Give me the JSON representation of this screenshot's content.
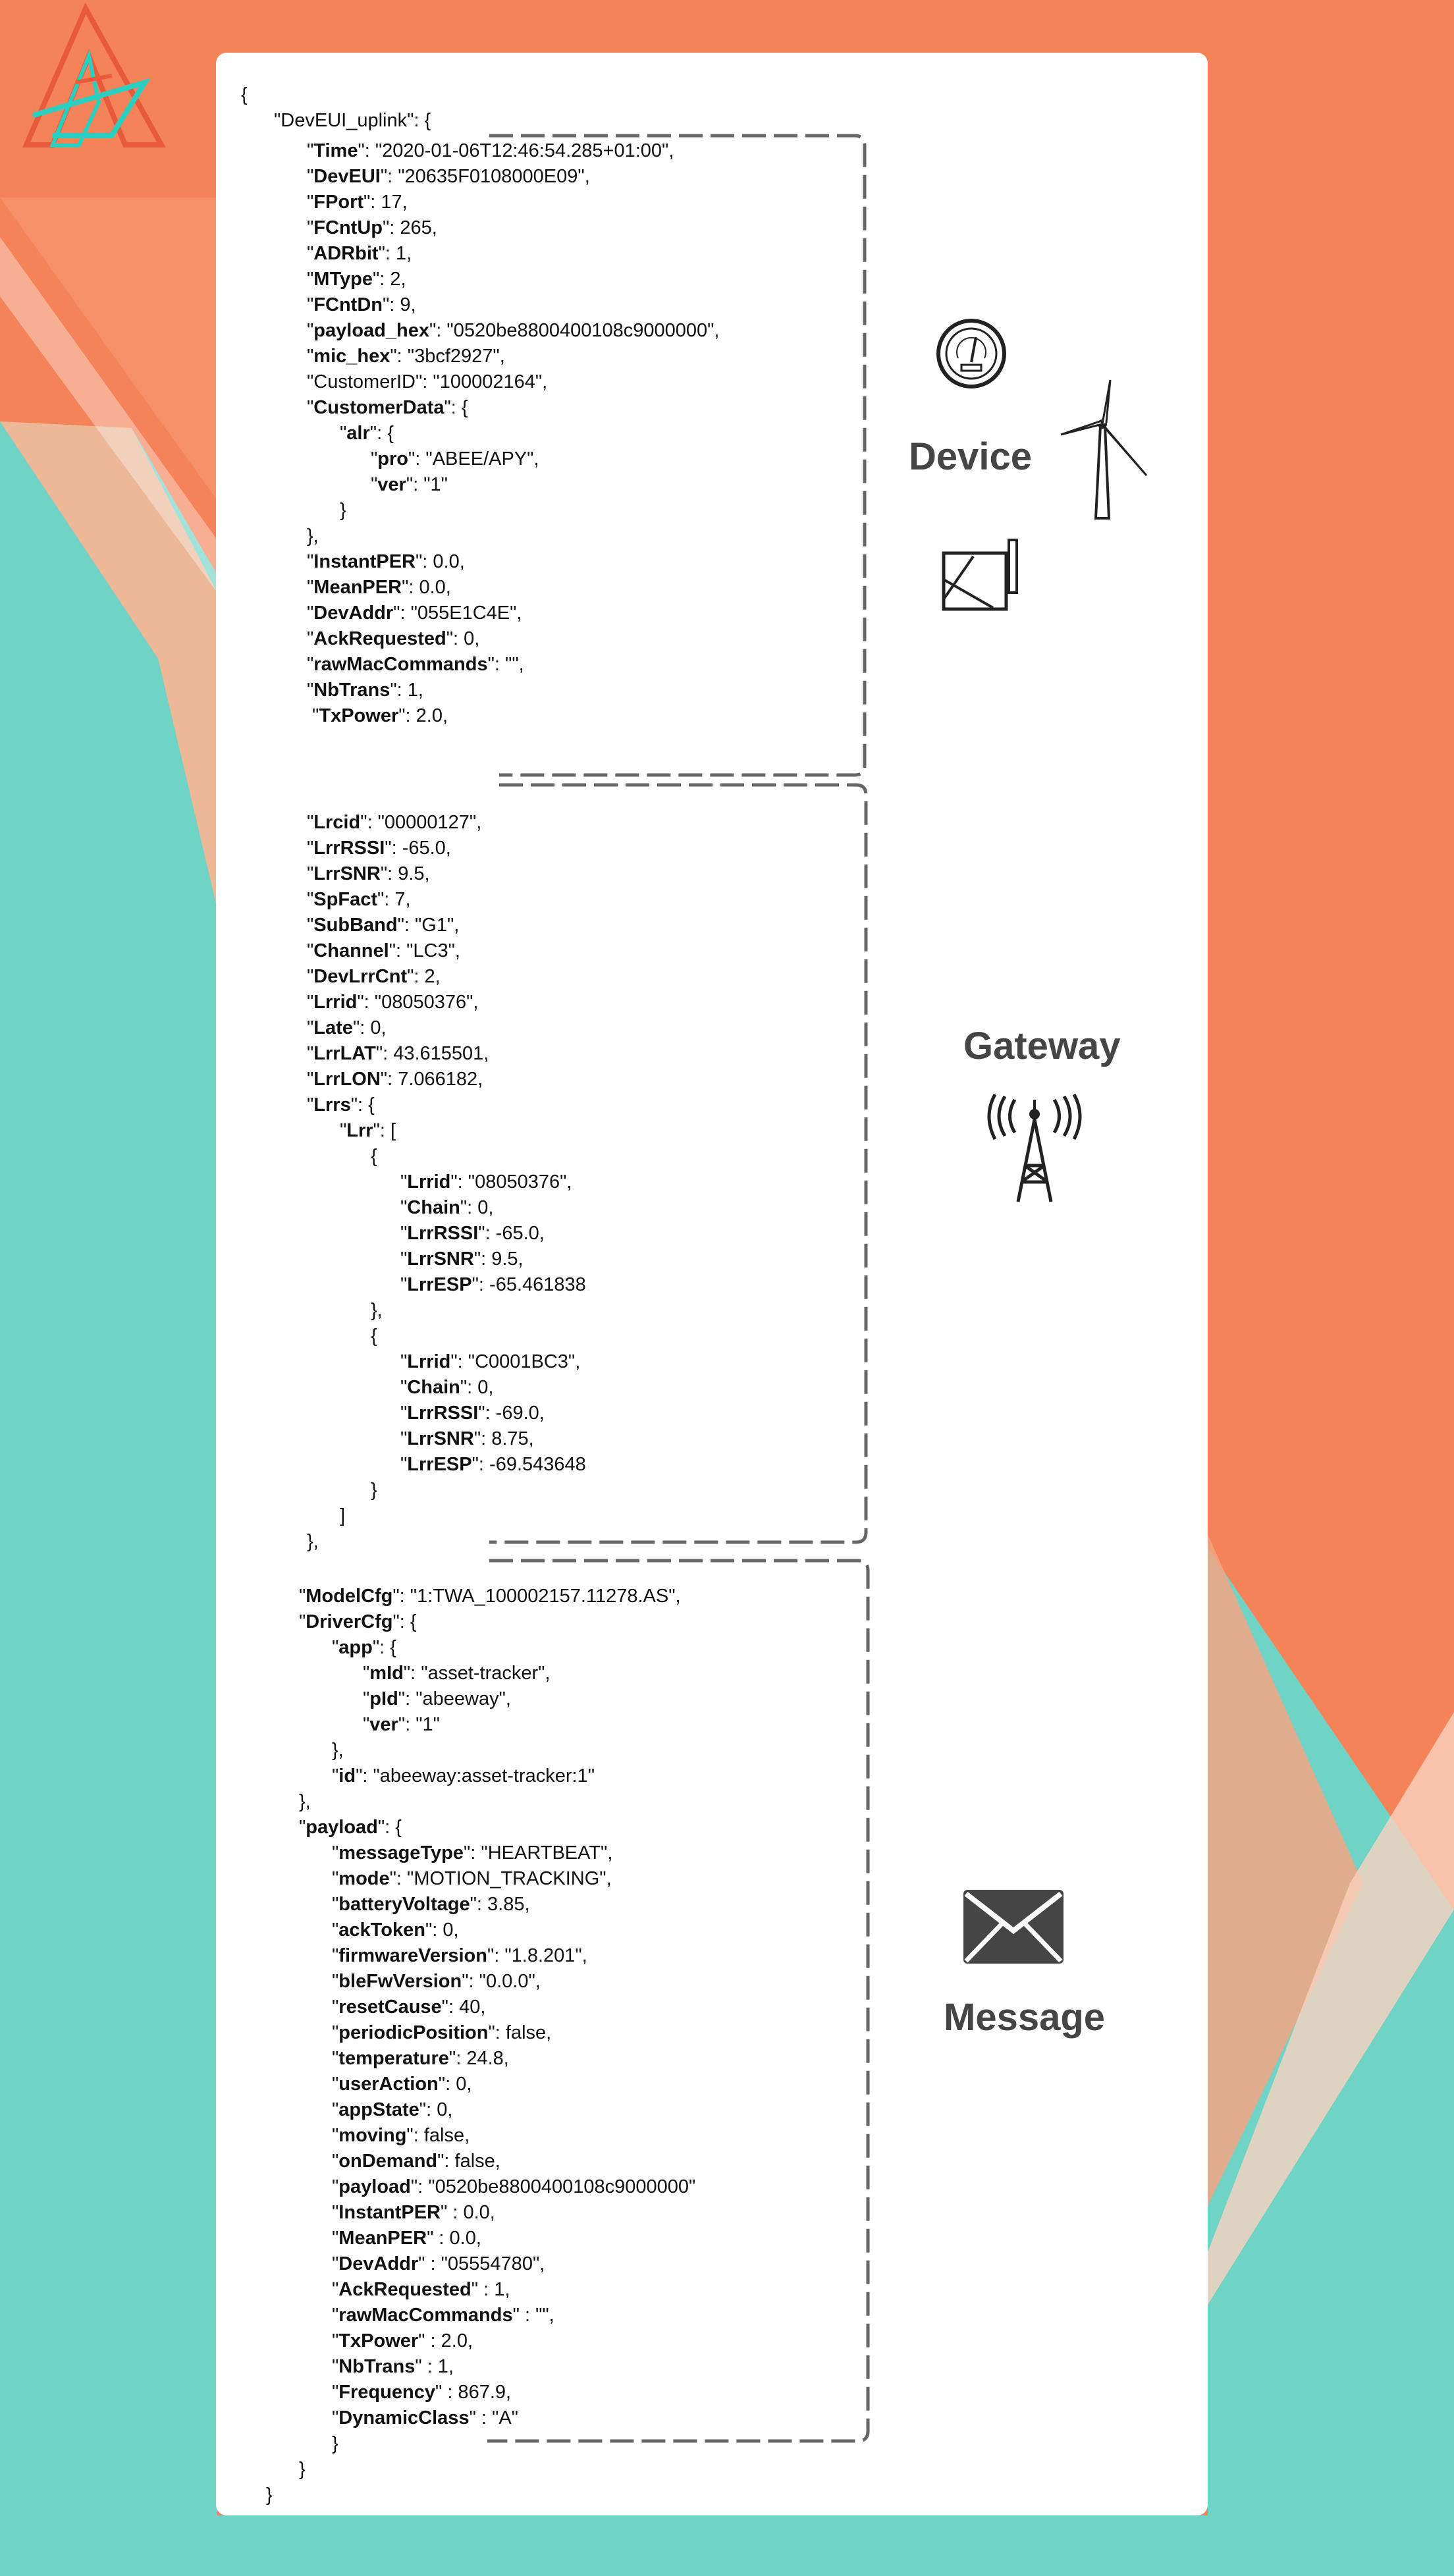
{
  "sections": {
    "device": {
      "label": "Device",
      "icons": [
        "gauge-icon",
        "wind-turbine-icon",
        "tracker-device-icon"
      ]
    },
    "gateway": {
      "label": "Gateway",
      "icons": [
        "antenna-tower-icon"
      ]
    },
    "message": {
      "label": "Message",
      "icons": [
        "envelope-icon"
      ]
    }
  },
  "colors": {
    "orange": "#F4835A",
    "teal": "#6FD3C6",
    "card": "#FFFFFF",
    "label": "#454545"
  },
  "json_lines": [
    {
      "i": 0,
      "p": "",
      "k": "",
      "v": "{"
    },
    {
      "i": 1,
      "p": "\"DevEUI_uplink\": {",
      "k": "",
      "v": ""
    },
    {
      "i": 2,
      "p": "\"",
      "k": "Time",
      "v": "\": \"2020-01-06T12:46:54.285+01:00\","
    },
    {
      "i": 2,
      "p": "\"",
      "k": "DevEUI",
      "v": "\": \"20635F0108000E09\","
    },
    {
      "i": 2,
      "p": "\"",
      "k": "FPort",
      "v": "\": 17,"
    },
    {
      "i": 2,
      "p": "\"",
      "k": "FCntUp",
      "v": "\": 265,"
    },
    {
      "i": 2,
      "p": "\"",
      "k": "ADRbit",
      "v": "\": 1,"
    },
    {
      "i": 2,
      "p": "\"",
      "k": "MType",
      "v": "\": 2,"
    },
    {
      "i": 2,
      "p": "\"",
      "k": "FCntDn",
      "v": "\": 9,"
    },
    {
      "i": 2,
      "p": "\"",
      "k": "payload_hex",
      "v": "\": \"0520be8800400108c9000000\","
    },
    {
      "i": 2,
      "p": "\"",
      "k": "mic_hex",
      "v": "\": \"3bcf2927\","
    },
    {
      "i": 2,
      "p": "\"",
      "k": "",
      "v": "CustomerID\": \"100002164\","
    },
    {
      "i": 2,
      "p": "\"",
      "k": "CustomerData",
      "v": "\": {"
    },
    {
      "i": 3,
      "p": "\"",
      "k": "alr",
      "v": "\": {"
    },
    {
      "i": 4,
      "p": "\"",
      "k": "pro",
      "v": "\": \"ABEE/APY\","
    },
    {
      "i": 4,
      "p": "\"",
      "k": "ver",
      "v": "\": \"1\""
    },
    {
      "i": 3,
      "p": "",
      "k": "",
      "v": "}"
    },
    {
      "i": 2,
      "p": "",
      "k": "",
      "v": "},"
    },
    {
      "i": 2,
      "p": "\"",
      "k": "InstantPER",
      "v": "\": 0.0,"
    },
    {
      "i": 2,
      "p": "\"",
      "k": "MeanPER",
      "v": "\": 0.0,"
    },
    {
      "i": 2,
      "p": "\"",
      "k": "DevAddr",
      "v": "\": \"055E1C4E\","
    },
    {
      "i": 2,
      "p": "\"",
      "k": "AckRequested",
      "v": "\": 0,"
    },
    {
      "i": 2,
      "p": "\"",
      "k": "rawMacCommands",
      "v": "\": \"\","
    },
    {
      "i": 2,
      "p": "\"",
      "k": "NbTrans",
      "v": "\": 1,"
    },
    {
      "i": 2,
      "p": " \"",
      "k": "TxPower",
      "v": "\": 2.0,"
    },
    {
      "i": 2,
      "p": "\"",
      "k": "Lrcid",
      "v": "\": \"00000127\","
    },
    {
      "i": 2,
      "p": "\"",
      "k": "LrrRSSI",
      "v": "\": -65.0,"
    },
    {
      "i": 2,
      "p": "\"",
      "k": "LrrSNR",
      "v": "\": 9.5,"
    },
    {
      "i": 2,
      "p": "\"",
      "k": "SpFact",
      "v": "\": 7,"
    },
    {
      "i": 2,
      "p": "\"",
      "k": "SubBand",
      "v": "\": \"G1\","
    },
    {
      "i": 2,
      "p": "\"",
      "k": "Channel",
      "v": "\": \"LC3\","
    },
    {
      "i": 2,
      "p": "\"",
      "k": "DevLrrCnt",
      "v": "\": 2,"
    },
    {
      "i": 2,
      "p": "\"",
      "k": "Lrrid",
      "v": "\": \"08050376\","
    },
    {
      "i": 2,
      "p": "\"",
      "k": "Late",
      "v": "\": 0,"
    },
    {
      "i": 2,
      "p": "\"",
      "k": "LrrLAT",
      "v": "\": 43.615501,"
    },
    {
      "i": 2,
      "p": "\"",
      "k": "LrrLON",
      "v": "\": 7.066182,"
    },
    {
      "i": 2,
      "p": "\"",
      "k": "Lrrs",
      "v": "\": {"
    },
    {
      "i": 3,
      "p": "\"",
      "k": "Lrr",
      "v": "\": ["
    },
    {
      "i": 4,
      "p": "",
      "k": "",
      "v": "{"
    },
    {
      "i": 5,
      "p": "\"",
      "k": "Lrrid",
      "v": "\": \"08050376\","
    },
    {
      "i": 5,
      "p": "\"",
      "k": "Chain",
      "v": "\": 0,"
    },
    {
      "i": 5,
      "p": "\"",
      "k": "LrrRSSI",
      "v": "\": -65.0,"
    },
    {
      "i": 5,
      "p": "\"",
      "k": "LrrSNR",
      "v": "\": 9.5,"
    },
    {
      "i": 5,
      "p": "\"",
      "k": "LrrESP",
      "v": "\": -65.461838"
    },
    {
      "i": 4,
      "p": "",
      "k": "",
      "v": "},"
    },
    {
      "i": 4,
      "p": "",
      "k": "",
      "v": "{"
    },
    {
      "i": 5,
      "p": "\"",
      "k": "Lrrid",
      "v": "\": \"C0001BC3\","
    },
    {
      "i": 5,
      "p": "\"",
      "k": "Chain",
      "v": "\": 0,"
    },
    {
      "i": 5,
      "p": "\"",
      "k": "LrrRSSI",
      "v": "\": -69.0,"
    },
    {
      "i": 5,
      "p": "\"",
      "k": "LrrSNR",
      "v": "\": 8.75,"
    },
    {
      "i": 5,
      "p": "\"",
      "k": "LrrESP",
      "v": "\": -69.543648"
    },
    {
      "i": 4,
      "p": "",
      "k": "",
      "v": "}"
    },
    {
      "i": 3,
      "p": "",
      "k": "",
      "v": "]"
    },
    {
      "i": 2,
      "p": "",
      "k": "",
      "v": "},"
    },
    {
      "i": 2,
      "p": "\"",
      "k": "ModelCfg",
      "v": "\": \"1:TWA_100002157.11278.AS\","
    },
    {
      "i": 2,
      "p": "\"",
      "k": "DriverCfg",
      "v": "\": {"
    },
    {
      "i": 3,
      "p": "\"",
      "k": "app",
      "v": "\": {"
    },
    {
      "i": 4,
      "p": "\"",
      "k": "mId",
      "v": "\": \"asset-tracker\","
    },
    {
      "i": 4,
      "p": "\"",
      "k": "pId",
      "v": "\": \"abeeway\","
    },
    {
      "i": 4,
      "p": "\"",
      "k": "ver",
      "v": "\": \"1\""
    },
    {
      "i": 3,
      "p": "",
      "k": "",
      "v": "},"
    },
    {
      "i": 3,
      "p": "\"",
      "k": "id",
      "v": "\": \"abeeway:asset-tracker:1\""
    },
    {
      "i": 2,
      "p": "",
      "k": "",
      "v": "},"
    },
    {
      "i": 2,
      "p": "\"",
      "k": "payload",
      "v": "\": {"
    },
    {
      "i": 3,
      "p": "\"",
      "k": "messageType",
      "v": "\": \"HEARTBEAT\","
    },
    {
      "i": 3,
      "p": "\"",
      "k": "mode",
      "v": "\": \"MOTION_TRACKING\","
    },
    {
      "i": 3,
      "p": "\"",
      "k": "batteryVoltage",
      "v": "\": 3.85,"
    },
    {
      "i": 3,
      "p": "\"",
      "k": "ackToken",
      "v": "\": 0,"
    },
    {
      "i": 3,
      "p": "\"",
      "k": "firmwareVersion",
      "v": "\": \"1.8.201\","
    },
    {
      "i": 3,
      "p": "\"",
      "k": "bleFwVersion",
      "v": "\": \"0.0.0\","
    },
    {
      "i": 3,
      "p": "\"",
      "k": "resetCause",
      "v": "\": 40,"
    },
    {
      "i": 3,
      "p": "\"",
      "k": "periodicPosition",
      "v": "\": false,"
    },
    {
      "i": 3,
      "p": "\"",
      "k": "temperature",
      "v": "\": 24.8,"
    },
    {
      "i": 3,
      "p": "\"",
      "k": "userAction",
      "v": "\": 0,"
    },
    {
      "i": 3,
      "p": "\"",
      "k": "appState",
      "v": "\": 0,"
    },
    {
      "i": 3,
      "p": "\"",
      "k": "moving",
      "v": "\": false,"
    },
    {
      "i": 3,
      "p": "\"",
      "k": "onDemand",
      "v": "\": false,"
    },
    {
      "i": 3,
      "p": "\"",
      "k": "payload",
      "v": "\": \"0520be8800400108c9000000\""
    },
    {
      "i": 3,
      "p": "\"",
      "k": "InstantPER",
      "v": "\" : 0.0,"
    },
    {
      "i": 3,
      "p": "\"",
      "k": "MeanPER",
      "v": "\" : 0.0,"
    },
    {
      "i": 3,
      "p": "\"",
      "k": "DevAddr",
      "v": "\" : \"05554780\","
    },
    {
      "i": 3,
      "p": "\"",
      "k": "AckRequested",
      "v": "\" : 1,"
    },
    {
      "i": 3,
      "p": "\"",
      "k": "rawMacCommands",
      "v": "\" : \"\","
    },
    {
      "i": 3,
      "p": "\"",
      "k": "TxPower",
      "v": "\" : 2.0,"
    },
    {
      "i": 3,
      "p": "\"",
      "k": "NbTrans",
      "v": "\" : 1,"
    },
    {
      "i": 3,
      "p": "\"",
      "k": "Frequency",
      "v": "\" : 867.9,"
    },
    {
      "i": 3,
      "p": "\"",
      "k": "DynamicClass",
      "v": "\" : \"A\""
    },
    {
      "i": 3,
      "p": "",
      "k": "",
      "v": "}"
    },
    {
      "i": 2,
      "p": "",
      "k": "",
      "v": "}"
    },
    {
      "i": 1,
      "p": "",
      "k": "",
      "v": "}"
    }
  ]
}
